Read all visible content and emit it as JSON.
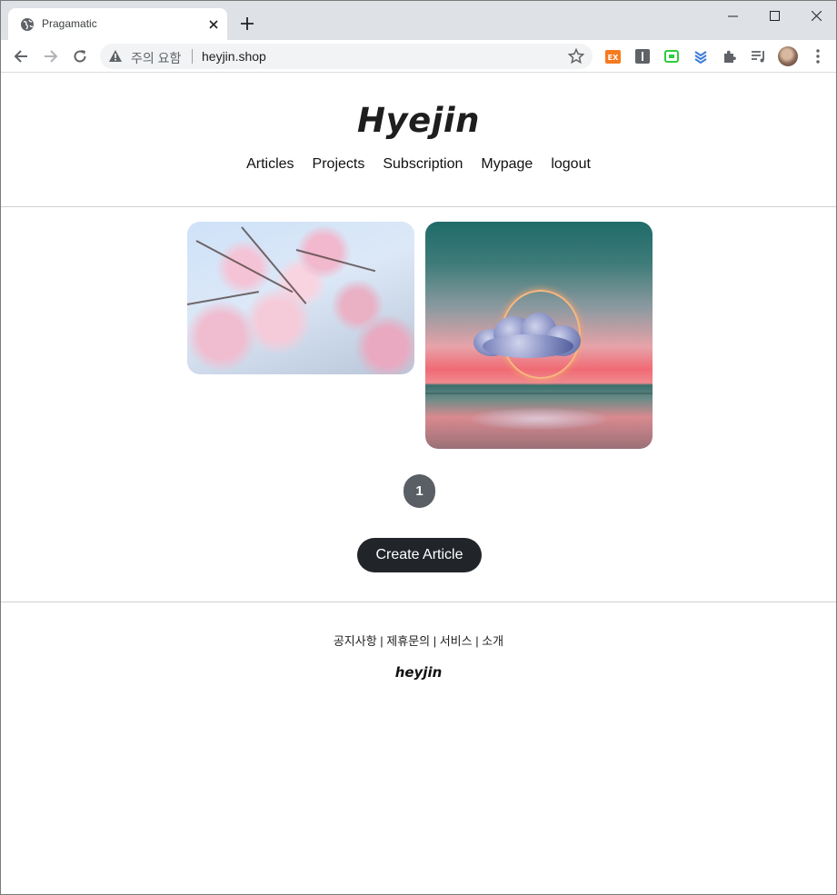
{
  "browser": {
    "tab": {
      "title": "Pragamatic",
      "favicon": "globe-icon"
    },
    "omnibox": {
      "security_warning": "주의 요함",
      "url": "heyjin.shop"
    },
    "extensions": [
      "ex-extension-icon",
      "i-extension-icon",
      "green-extension-icon",
      "layers-extension-icon",
      "puzzle-icon",
      "media-icon"
    ]
  },
  "site": {
    "logo": "Hyejin",
    "menu": [
      "Articles",
      "Projects",
      "Subscription",
      "Mypage",
      "logout"
    ],
    "articles": [
      {
        "image": "cherry-blossom-photo"
      },
      {
        "image": "cloud-sunset-photo"
      }
    ],
    "pagination": {
      "current": "1"
    },
    "create_button": "Create Article",
    "footer": {
      "links": "공지사항 | 제휴문의 | 서비스 | 소개",
      "logo": "heyjin"
    }
  },
  "colors": {
    "tab_strip": "#dee1e6",
    "button_dark": "#212529",
    "page_button": "#5a5f66"
  }
}
